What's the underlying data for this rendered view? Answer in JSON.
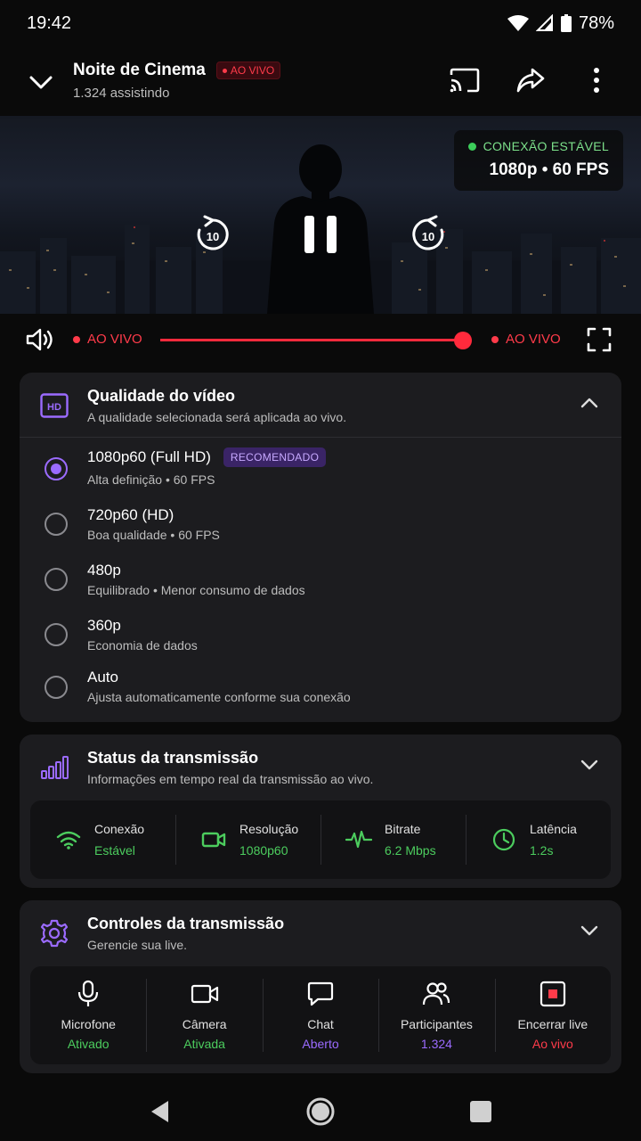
{
  "status_bar": {
    "time": "19:42",
    "battery": "78%"
  },
  "header": {
    "title": "Noite de Cinema",
    "live_badge": "AO VIVO",
    "viewers": "1.324 assistindo"
  },
  "video": {
    "connection_status": "CONEXÃO ESTÁVEL",
    "resolution_fps": "1080p • 60 FPS",
    "rewind_seconds": "10",
    "forward_seconds": "10"
  },
  "progress": {
    "left_label": "AO VIVO",
    "right_label": "AO VIVO",
    "position_fraction": 1.0
  },
  "quality": {
    "title": "Qualidade do vídeo",
    "subtitle": "A qualidade selecionada será aplicada ao vivo.",
    "options": [
      {
        "title": "1080p60 (Full HD)",
        "subtitle": "Alta definição • 60 FPS",
        "badge": "RECOMENDADO",
        "selected": true
      },
      {
        "title": "720p60 (HD)",
        "subtitle": "Boa qualidade • 60 FPS",
        "selected": false
      },
      {
        "title": "480p",
        "subtitle": "Equilibrado • Menor consumo de dados",
        "selected": false
      },
      {
        "title": "360p",
        "subtitle": "Economia de dados",
        "selected": false
      },
      {
        "title": "Auto",
        "subtitle": "Ajusta automaticamente conforme sua conexão",
        "selected": false
      }
    ]
  },
  "status": {
    "title": "Status da transmissão",
    "subtitle": "Informações em tempo real da transmissão ao vivo.",
    "stats": [
      {
        "label": "Conexão",
        "value": "Estável",
        "icon": "wifi-icon"
      },
      {
        "label": "Resolução",
        "value": "1080p60",
        "icon": "video-camera-icon"
      },
      {
        "label": "Bitrate",
        "value": "6.2 Mbps",
        "icon": "pulse-icon"
      },
      {
        "label": "Latência",
        "value": "1.2s",
        "icon": "clock-icon"
      }
    ]
  },
  "controls": {
    "title": "Controles da transmissão",
    "subtitle": "Gerencie sua live.",
    "items": [
      {
        "label": "Microfone",
        "value": "Ativado",
        "icon": "microphone-icon",
        "color": "#4ccd5e"
      },
      {
        "label": "Câmera",
        "value": "Ativada",
        "icon": "camera-icon",
        "color": "#4ccd5e"
      },
      {
        "label": "Chat",
        "value": "Aberto",
        "icon": "chat-icon",
        "color": "#9b6bff"
      },
      {
        "label": "Participantes",
        "value": "1.324",
        "icon": "people-icon",
        "color": "#9b6bff"
      },
      {
        "label": "Encerrar live",
        "value": "Ao vivo",
        "icon": "stop-icon",
        "color": "#ff3b4a"
      }
    ]
  },
  "colors": {
    "accent_purple": "#9b6bff",
    "live_red": "#ff3b4a",
    "ok_green": "#4ccd5e"
  }
}
